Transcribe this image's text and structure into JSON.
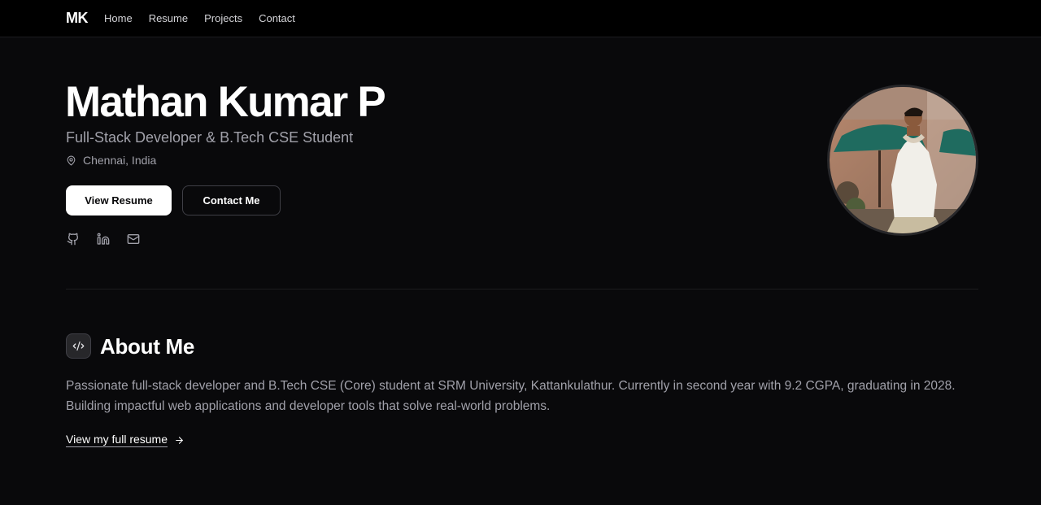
{
  "nav": {
    "logo": "MK",
    "links": [
      "Home",
      "Resume",
      "Projects",
      "Contact"
    ]
  },
  "hero": {
    "name": "Mathan Kumar P",
    "subtitle": "Full-Stack Developer & B.Tech CSE Student",
    "location": "Chennai, India",
    "primary_button": "View Resume",
    "secondary_button": "Contact Me",
    "socials": [
      "github-icon",
      "linkedin-icon",
      "mail-icon"
    ]
  },
  "about": {
    "title": "About Me",
    "text": "Passionate full-stack developer and B.Tech CSE (Core) student at SRM University, Kattankulathur. Currently in second year with 9.2 CGPA, graduating in 2028. Building impactful web applications and developer tools that solve real-world problems.",
    "link": "View my full resume"
  },
  "colors": {
    "background": "#09090b",
    "text": "#fafafa",
    "muted": "#a1a1aa",
    "border": "#3f3f46"
  }
}
